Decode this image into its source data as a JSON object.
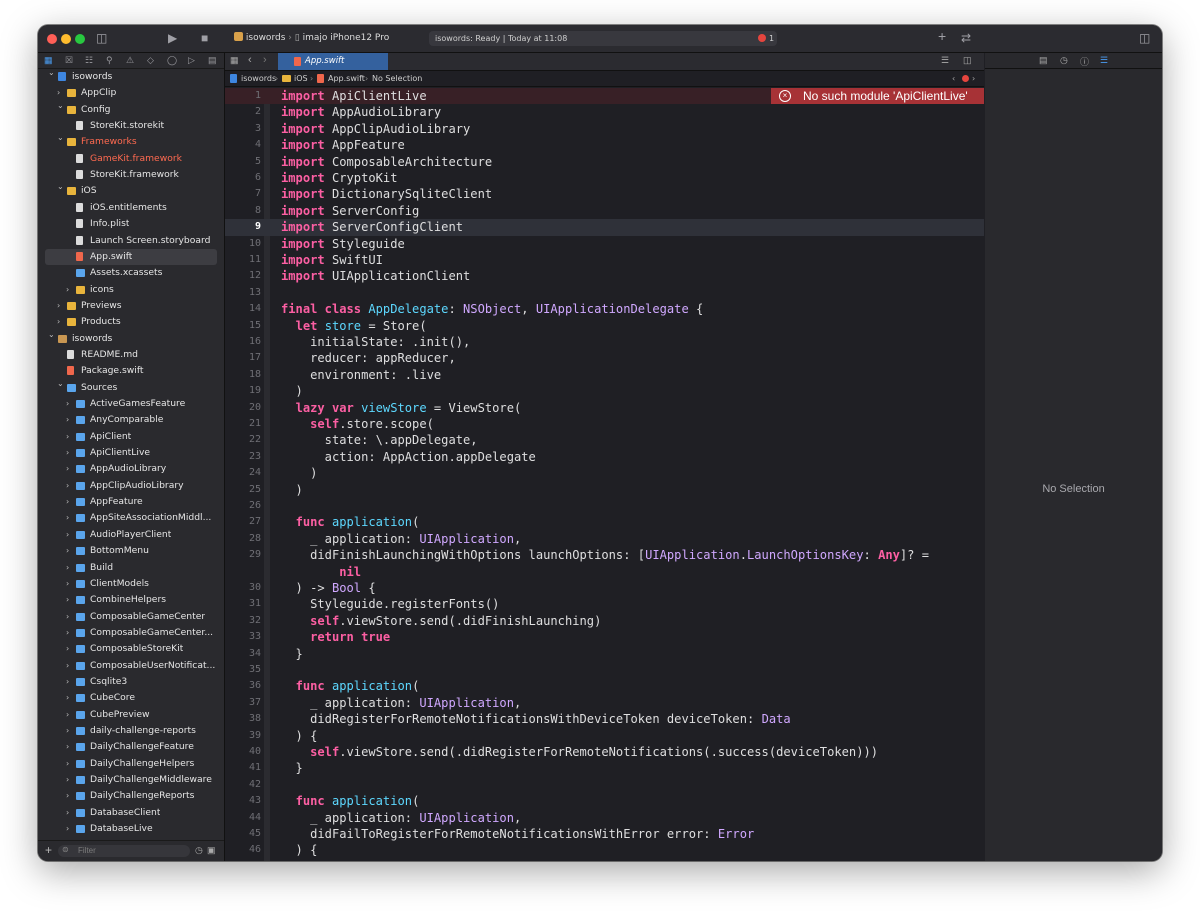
{
  "toolbar": {
    "scheme": "isowords",
    "device": "imajo iPhone12 Pro",
    "status_text": "isowords: Ready | Today at 11:08",
    "error_count": "1"
  },
  "tab": {
    "label": "App.swift"
  },
  "breadcrumb": [
    "isowords",
    "iOS",
    "App.swift",
    "No Selection"
  ],
  "sidebar": {
    "filter_placeholder": "Filter",
    "rows": [
      {
        "label": "isowords",
        "type": "proj",
        "expanded": true,
        "depth": 0
      },
      {
        "label": "AppClip",
        "type": "folder-yellow",
        "expanded": false,
        "depth": 1
      },
      {
        "label": "Config",
        "type": "folder-yellow",
        "expanded": true,
        "depth": 1
      },
      {
        "label": "StoreKit.storekit",
        "type": "doc",
        "depth": 2
      },
      {
        "label": "Frameworks",
        "type": "folder-yellow",
        "expanded": true,
        "depth": 1,
        "red": true
      },
      {
        "label": "GameKit.framework",
        "type": "doc",
        "depth": 2,
        "red": true
      },
      {
        "label": "StoreKit.framework",
        "type": "doc",
        "depth": 2
      },
      {
        "label": "iOS",
        "type": "folder-yellow",
        "expanded": true,
        "depth": 1
      },
      {
        "label": "iOS.entitlements",
        "type": "doc",
        "depth": 2
      },
      {
        "label": "Info.plist",
        "type": "doc",
        "depth": 2
      },
      {
        "label": "Launch Screen.storyboard",
        "type": "doc",
        "depth": 2
      },
      {
        "label": "App.swift",
        "type": "swift",
        "depth": 2,
        "selected": true
      },
      {
        "label": "Assets.xcassets",
        "type": "folder-blue",
        "depth": 2
      },
      {
        "label": "icons",
        "type": "folder-yellow",
        "expanded": false,
        "depth": 2
      },
      {
        "label": "Previews",
        "type": "folder-yellow",
        "expanded": false,
        "depth": 1
      },
      {
        "label": "Products",
        "type": "folder-yellow",
        "expanded": false,
        "depth": 1
      },
      {
        "label": "isowords",
        "type": "pkg",
        "expanded": true,
        "depth": 0
      },
      {
        "label": "README.md",
        "type": "doc",
        "depth": 1
      },
      {
        "label": "Package.swift",
        "type": "swift",
        "depth": 1
      },
      {
        "label": "Sources",
        "type": "folder-blue",
        "expanded": true,
        "depth": 1
      },
      {
        "label": "ActiveGamesFeature",
        "type": "folder-blue",
        "expanded": false,
        "depth": 2
      },
      {
        "label": "AnyComparable",
        "type": "folder-blue",
        "expanded": false,
        "depth": 2
      },
      {
        "label": "ApiClient",
        "type": "folder-blue",
        "expanded": false,
        "depth": 2
      },
      {
        "label": "ApiClientLive",
        "type": "folder-blue",
        "expanded": false,
        "depth": 2
      },
      {
        "label": "AppAudioLibrary",
        "type": "folder-blue",
        "expanded": false,
        "depth": 2
      },
      {
        "label": "AppClipAudioLibrary",
        "type": "folder-blue",
        "expanded": false,
        "depth": 2
      },
      {
        "label": "AppFeature",
        "type": "folder-blue",
        "expanded": false,
        "depth": 2
      },
      {
        "label": "AppSiteAssociationMiddl...",
        "type": "folder-blue",
        "expanded": false,
        "depth": 2
      },
      {
        "label": "AudioPlayerClient",
        "type": "folder-blue",
        "expanded": false,
        "depth": 2
      },
      {
        "label": "BottomMenu",
        "type": "folder-blue",
        "expanded": false,
        "depth": 2
      },
      {
        "label": "Build",
        "type": "folder-blue",
        "expanded": false,
        "depth": 2
      },
      {
        "label": "ClientModels",
        "type": "folder-blue",
        "expanded": false,
        "depth": 2
      },
      {
        "label": "CombineHelpers",
        "type": "folder-blue",
        "expanded": false,
        "depth": 2
      },
      {
        "label": "ComposableGameCenter",
        "type": "folder-blue",
        "expanded": false,
        "depth": 2
      },
      {
        "label": "ComposableGameCenter...",
        "type": "folder-blue",
        "expanded": false,
        "depth": 2
      },
      {
        "label": "ComposableStoreKit",
        "type": "folder-blue",
        "expanded": false,
        "depth": 2
      },
      {
        "label": "ComposableUserNotificat...",
        "type": "folder-blue",
        "expanded": false,
        "depth": 2
      },
      {
        "label": "Csqlite3",
        "type": "folder-blue",
        "expanded": false,
        "depth": 2
      },
      {
        "label": "CubeCore",
        "type": "folder-blue",
        "expanded": false,
        "depth": 2
      },
      {
        "label": "CubePreview",
        "type": "folder-blue",
        "expanded": false,
        "depth": 2
      },
      {
        "label": "daily-challenge-reports",
        "type": "folder-blue",
        "expanded": false,
        "depth": 2
      },
      {
        "label": "DailyChallengeFeature",
        "type": "folder-blue",
        "expanded": false,
        "depth": 2
      },
      {
        "label": "DailyChallengeHelpers",
        "type": "folder-blue",
        "expanded": false,
        "depth": 2
      },
      {
        "label": "DailyChallengeMiddleware",
        "type": "folder-blue",
        "expanded": false,
        "depth": 2
      },
      {
        "label": "DailyChallengeReports",
        "type": "folder-blue",
        "expanded": false,
        "depth": 2
      },
      {
        "label": "DatabaseClient",
        "type": "folder-blue",
        "expanded": false,
        "depth": 2
      },
      {
        "label": "DatabaseLive",
        "type": "folder-blue",
        "expanded": false,
        "depth": 2
      }
    ]
  },
  "editor": {
    "error_message": "No such module 'ApiClientLive'",
    "current_line": 9,
    "lines": [
      {
        "n": "1",
        "segs": [
          [
            "kw",
            "import"
          ],
          [
            "",
            " ApiClientLive"
          ]
        ]
      },
      {
        "n": "2",
        "segs": [
          [
            "kw",
            "import"
          ],
          [
            "",
            " AppAudioLibrary"
          ]
        ]
      },
      {
        "n": "3",
        "segs": [
          [
            "kw",
            "import"
          ],
          [
            "",
            " AppClipAudioLibrary"
          ]
        ]
      },
      {
        "n": "4",
        "segs": [
          [
            "kw",
            "import"
          ],
          [
            "",
            " AppFeature"
          ]
        ]
      },
      {
        "n": "5",
        "segs": [
          [
            "kw",
            "import"
          ],
          [
            "",
            " ComposableArchitecture"
          ]
        ]
      },
      {
        "n": "6",
        "segs": [
          [
            "kw",
            "import"
          ],
          [
            "",
            " CryptoKit"
          ]
        ]
      },
      {
        "n": "7",
        "segs": [
          [
            "kw",
            "import"
          ],
          [
            "",
            " DictionarySqliteClient"
          ]
        ]
      },
      {
        "n": "8",
        "segs": [
          [
            "kw",
            "import"
          ],
          [
            "",
            " ServerConfig"
          ]
        ]
      },
      {
        "n": "9",
        "segs": [
          [
            "kw",
            "import"
          ],
          [
            "",
            " ServerConfigClient"
          ]
        ]
      },
      {
        "n": "10",
        "segs": [
          [
            "kw",
            "import"
          ],
          [
            "",
            " Styleguide"
          ]
        ]
      },
      {
        "n": "11",
        "segs": [
          [
            "kw",
            "import"
          ],
          [
            "",
            " SwiftUI"
          ]
        ]
      },
      {
        "n": "12",
        "segs": [
          [
            "kw",
            "import"
          ],
          [
            "",
            " UIApplicationClient"
          ]
        ]
      },
      {
        "n": "13",
        "segs": []
      },
      {
        "n": "14",
        "segs": [
          [
            "kw",
            "final class"
          ],
          [
            "",
            " "
          ],
          [
            "dc",
            "AppDelegate"
          ],
          [
            "",
            ": "
          ],
          [
            "ty",
            "NSObject"
          ],
          [
            "",
            ", "
          ],
          [
            "ty",
            "UIApplicationDelegate"
          ],
          [
            "",
            " {"
          ]
        ]
      },
      {
        "n": "15",
        "segs": [
          [
            "",
            "  "
          ],
          [
            "kw",
            "let"
          ],
          [
            "",
            " "
          ],
          [
            "dc",
            "store"
          ],
          [
            "",
            " = Store("
          ]
        ]
      },
      {
        "n": "16",
        "segs": [
          [
            "",
            "    initialState: .init(),"
          ]
        ]
      },
      {
        "n": "17",
        "segs": [
          [
            "",
            "    reducer: appReducer,"
          ]
        ]
      },
      {
        "n": "18",
        "segs": [
          [
            "",
            "    environment: .live"
          ]
        ]
      },
      {
        "n": "19",
        "segs": [
          [
            "",
            "  )"
          ]
        ]
      },
      {
        "n": "20",
        "segs": [
          [
            "",
            "  "
          ],
          [
            "kw",
            "lazy var"
          ],
          [
            "",
            " "
          ],
          [
            "dc",
            "viewStore"
          ],
          [
            "",
            " = ViewStore("
          ]
        ]
      },
      {
        "n": "21",
        "segs": [
          [
            "",
            "    "
          ],
          [
            "kw",
            "self"
          ],
          [
            "",
            ".store.scope("
          ]
        ]
      },
      {
        "n": "22",
        "segs": [
          [
            "",
            "      state: \\.appDelegate,"
          ]
        ]
      },
      {
        "n": "23",
        "segs": [
          [
            "",
            "      action: AppAction.appDelegate"
          ]
        ]
      },
      {
        "n": "24",
        "segs": [
          [
            "",
            "    )"
          ]
        ]
      },
      {
        "n": "25",
        "segs": [
          [
            "",
            "  )"
          ]
        ]
      },
      {
        "n": "26",
        "segs": []
      },
      {
        "n": "27",
        "segs": [
          [
            "",
            "  "
          ],
          [
            "kw",
            "func"
          ],
          [
            "",
            " "
          ],
          [
            "dc",
            "application"
          ],
          [
            "",
            "("
          ]
        ]
      },
      {
        "n": "28",
        "segs": [
          [
            "",
            "    _ application: "
          ],
          [
            "ty",
            "UIApplication"
          ],
          [
            "",
            ","
          ]
        ]
      },
      {
        "n": "29",
        "segs": [
          [
            "",
            "    didFinishLaunchingWithOptions launchOptions: ["
          ],
          [
            "ty",
            "UIApplication"
          ],
          [
            "",
            "."
          ],
          [
            "ty",
            "LaunchOptionsKey"
          ],
          [
            "",
            ": "
          ],
          [
            "kw",
            "Any"
          ],
          [
            "",
            "]? ="
          ]
        ]
      },
      {
        "n": "",
        "segs": [
          [
            "",
            "        "
          ],
          [
            "kw",
            "nil"
          ]
        ]
      },
      {
        "n": "30",
        "segs": [
          [
            "",
            "  ) -> "
          ],
          [
            "ty",
            "Bool"
          ],
          [
            "",
            " {"
          ]
        ]
      },
      {
        "n": "31",
        "segs": [
          [
            "",
            "    Styleguide.registerFonts()"
          ]
        ]
      },
      {
        "n": "32",
        "segs": [
          [
            "",
            "    "
          ],
          [
            "kw",
            "self"
          ],
          [
            "",
            ".viewStore.send(.didFinishLaunching)"
          ]
        ]
      },
      {
        "n": "33",
        "segs": [
          [
            "",
            "    "
          ],
          [
            "kw",
            "return true"
          ]
        ]
      },
      {
        "n": "34",
        "segs": [
          [
            "",
            "  }"
          ]
        ]
      },
      {
        "n": "35",
        "segs": []
      },
      {
        "n": "36",
        "segs": [
          [
            "",
            "  "
          ],
          [
            "kw",
            "func"
          ],
          [
            "",
            " "
          ],
          [
            "dc",
            "application"
          ],
          [
            "",
            "("
          ]
        ]
      },
      {
        "n": "37",
        "segs": [
          [
            "",
            "    _ application: "
          ],
          [
            "ty",
            "UIApplication"
          ],
          [
            "",
            ","
          ]
        ]
      },
      {
        "n": "38",
        "segs": [
          [
            "",
            "    didRegisterForRemoteNotificationsWithDeviceToken deviceToken: "
          ],
          [
            "ty",
            "Data"
          ]
        ]
      },
      {
        "n": "39",
        "segs": [
          [
            "",
            "  ) {"
          ]
        ]
      },
      {
        "n": "40",
        "segs": [
          [
            "",
            "    "
          ],
          [
            "kw",
            "self"
          ],
          [
            "",
            ".viewStore.send(.didRegisterForRemoteNotifications(.success(deviceToken)))"
          ]
        ]
      },
      {
        "n": "41",
        "segs": [
          [
            "",
            "  }"
          ]
        ]
      },
      {
        "n": "42",
        "segs": []
      },
      {
        "n": "43",
        "segs": [
          [
            "",
            "  "
          ],
          [
            "kw",
            "func"
          ],
          [
            "",
            " "
          ],
          [
            "dc",
            "application"
          ],
          [
            "",
            "("
          ]
        ]
      },
      {
        "n": "44",
        "segs": [
          [
            "",
            "    _ application: "
          ],
          [
            "ty",
            "UIApplication"
          ],
          [
            "",
            ","
          ]
        ]
      },
      {
        "n": "45",
        "segs": [
          [
            "",
            "    didFailToRegisterForRemoteNotificationsWithError error: "
          ],
          [
            "ty",
            "Error"
          ]
        ]
      },
      {
        "n": "46",
        "segs": [
          [
            "",
            "  ) {"
          ]
        ]
      }
    ]
  },
  "inspector": {
    "empty_label": "No Selection"
  }
}
